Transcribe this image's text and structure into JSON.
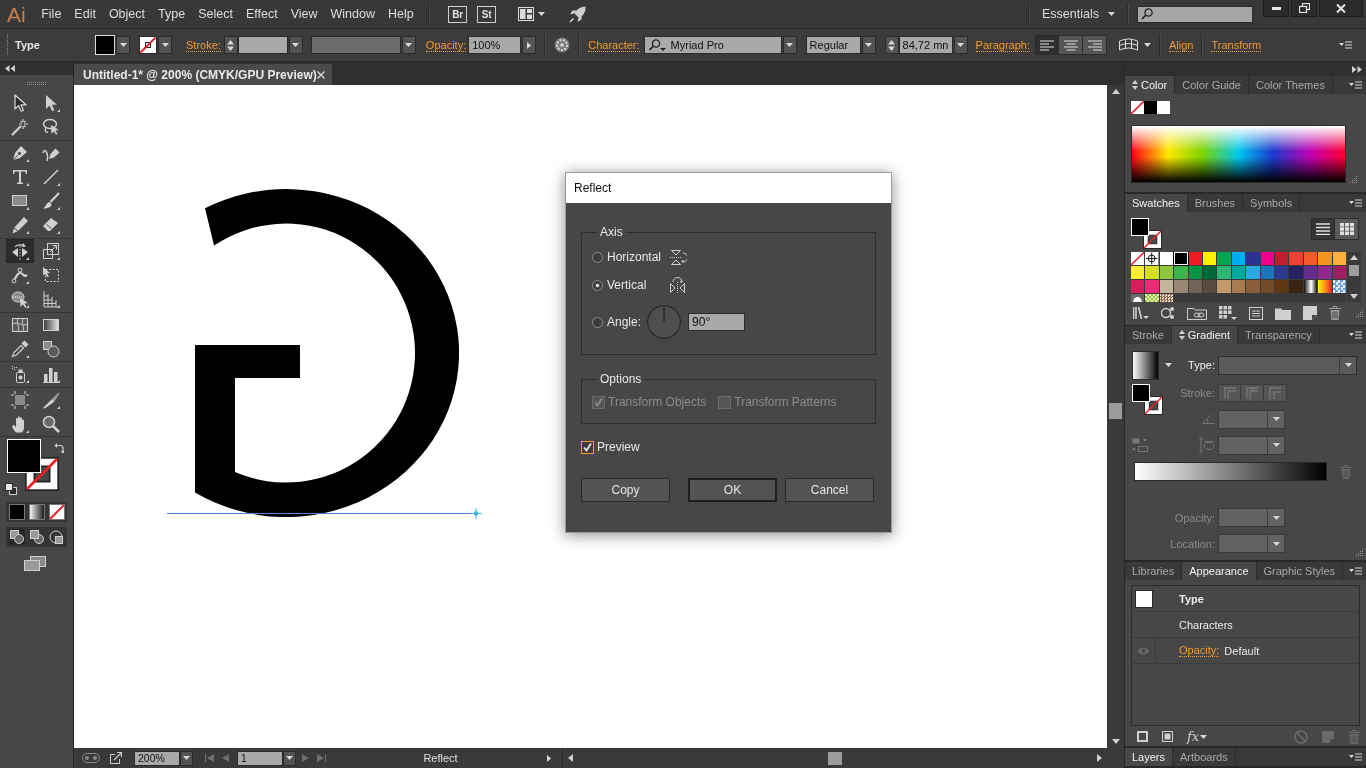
{
  "menu_bar": {
    "logo": "Ai",
    "menus": [
      "File",
      "Edit",
      "Object",
      "Type",
      "Select",
      "Effect",
      "View",
      "Window",
      "Help"
    ],
    "bridge_button": "Br",
    "stock_button": "St",
    "workspace": "Essentials"
  },
  "control_bar": {
    "selection": "Type",
    "stroke_label": "Stroke:",
    "opacity_label": "Opacity:",
    "opacity": "100%",
    "character_label": "Character:",
    "font_family": "Myriad Pro",
    "font_style": "Regular",
    "font_size": "84,72 mn",
    "paragraph_label": "Paragraph:",
    "alignment": [
      {
        "selected": true
      },
      {
        "selected": false
      },
      {
        "selected": false
      }
    ],
    "align_label": "Align",
    "transform_label": "Transform"
  },
  "toolbar": {
    "tools": [
      {
        "selected": false
      },
      {
        "selected": false
      },
      {
        "selected": false
      },
      {
        "selected": false
      },
      {
        "selected": false
      },
      {
        "selected": false
      },
      {
        "selected": false
      },
      {
        "selected": false
      },
      {
        "selected": false
      },
      {
        "selected": false
      },
      {
        "selected": false
      },
      {
        "selected": false
      },
      {
        "selected": true
      },
      {
        "selected": false
      },
      {
        "selected": false
      },
      {
        "selected": false
      },
      {
        "selected": false
      },
      {
        "selected": false
      },
      {
        "selected": false
      },
      {
        "selected": false
      },
      {
        "selected": false
      },
      {
        "selected": false
      },
      {
        "selected": false
      },
      {
        "selected": false
      },
      {
        "selected": false
      },
      {
        "selected": false
      },
      {
        "selected": false
      },
      {
        "selected": false
      }
    ],
    "draw_modes": [
      {
        "selected": true
      },
      {
        "selected": false
      },
      {
        "selected": false
      }
    ]
  },
  "document_tab": {
    "title": "Untitled-1* @ 200% (CMYK/GPU Preview)"
  },
  "dialog": {
    "title": "Reflect",
    "axis": {
      "label": "Axis",
      "options": [
        {
          "label": "Horizontal",
          "kind": "flip",
          "selected": false
        },
        {
          "label": "Vertical",
          "kind": "flip",
          "selected": true
        },
        {
          "label": "Angle:",
          "kind": "angle",
          "selected": false,
          "value": "90°"
        }
      ]
    },
    "options": {
      "label": "Options",
      "checkboxes": [
        {
          "label": "Transform Objects",
          "checked": true,
          "disabled": true
        },
        {
          "label": "Transform Patterns",
          "checked": false,
          "disabled": true
        }
      ]
    },
    "preview": {
      "label": "Preview",
      "checked": true,
      "focused": true
    },
    "buttons": [
      {
        "label": "Copy",
        "default": false
      },
      {
        "label": "OK",
        "default": true
      },
      {
        "label": "Cancel",
        "default": false
      }
    ]
  },
  "color_panel": {
    "tabs": [
      {
        "label": "Color",
        "selected": true
      },
      {
        "label": "Color Guide",
        "selected": false
      },
      {
        "label": "Color Themes",
        "selected": false
      }
    ],
    "options_toggle": true,
    "quick_swatches": [
      {
        "kind": "none"
      },
      {
        "kind": "color",
        "color": "#000000"
      },
      {
        "kind": "color",
        "color": "#ffffff"
      }
    ]
  },
  "swatches_panel": {
    "tabs": [
      {
        "label": "Swatches",
        "selected": true
      },
      {
        "label": "Brushes",
        "selected": false
      },
      {
        "label": "Symbols",
        "selected": false
      }
    ],
    "views": [
      {
        "selected": true
      },
      {
        "selected": false
      }
    ],
    "swatches": [
      {
        "kind": "none",
        "selected": false
      },
      {
        "kind": "registration",
        "selected": false
      },
      {
        "kind": "color",
        "color": "#ffffff",
        "selected": false
      },
      {
        "kind": "color",
        "color": "#000000",
        "selected": true
      },
      {
        "kind": "color",
        "color": "#ed1c24",
        "selected": false
      },
      {
        "kind": "color",
        "color": "#fff200",
        "selected": false
      },
      {
        "kind": "color",
        "color": "#00a651",
        "selected": false
      },
      {
        "kind": "color",
        "color": "#00aeef",
        "selected": false
      },
      {
        "kind": "color",
        "color": "#2e3192",
        "selected": false
      },
      {
        "kind": "color",
        "color": "#ec008c",
        "selected": false
      },
      {
        "kind": "color",
        "color": "#be1e2d",
        "selected": false
      },
      {
        "kind": "color",
        "color": "#ef4136",
        "selected": false
      },
      {
        "kind": "color",
        "color": "#f15a29",
        "selected": false
      },
      {
        "kind": "color",
        "color": "#f7941d",
        "selected": false
      },
      {
        "kind": "color",
        "color": "#fbb040",
        "selected": false
      },
      {
        "kind": "color",
        "color": "#f9ed32",
        "selected": false
      },
      {
        "kind": "color",
        "color": "#d7df23",
        "selected": false
      },
      {
        "kind": "color",
        "color": "#8dc63f",
        "selected": false
      },
      {
        "kind": "color",
        "color": "#39b54a",
        "selected": false
      },
      {
        "kind": "color",
        "color": "#009444",
        "selected": false
      },
      {
        "kind": "color",
        "color": "#006838",
        "selected": false
      },
      {
        "kind": "color",
        "color": "#2bb673",
        "selected": false
      },
      {
        "kind": "color",
        "color": "#00a79d",
        "selected": false
      },
      {
        "kind": "color",
        "color": "#27aae1",
        "selected": false
      },
      {
        "kind": "color",
        "color": "#1c75bc",
        "selected": false
      },
      {
        "kind": "color",
        "color": "#2b3990",
        "selected": false
      },
      {
        "kind": "color",
        "color": "#262262",
        "selected": false
      },
      {
        "kind": "color",
        "color": "#662d91",
        "selected": false
      },
      {
        "kind": "color",
        "color": "#92278f",
        "selected": false
      },
      {
        "kind": "color",
        "color": "#9e1f63",
        "selected": false
      },
      {
        "kind": "color",
        "color": "#da1c5c",
        "selected": false
      },
      {
        "kind": "color",
        "color": "#ee2a7b",
        "selected": false
      },
      {
        "kind": "color",
        "color": "#c2b59b",
        "selected": false
      },
      {
        "kind": "color",
        "color": "#998675",
        "selected": false
      },
      {
        "kind": "color",
        "color": "#736357",
        "selected": false
      },
      {
        "kind": "color",
        "color": "#594a42",
        "selected": false
      },
      {
        "kind": "color",
        "color": "#c49a6c",
        "selected": false
      },
      {
        "kind": "color",
        "color": "#a97c50",
        "selected": false
      },
      {
        "kind": "color",
        "color": "#8b5e3c",
        "selected": false
      },
      {
        "kind": "color",
        "color": "#754c29",
        "selected": false
      },
      {
        "kind": "color",
        "color": "#603913",
        "selected": false
      },
      {
        "kind": "color",
        "color": "#3c2415",
        "selected": false
      },
      {
        "kind": "gradient",
        "selected": false
      },
      {
        "kind": "gradient",
        "selected": false
      },
      {
        "kind": "pattern",
        "selected": false
      },
      {
        "kind": "pattern",
        "selected": false
      },
      {
        "kind": "pattern",
        "selected": false
      },
      {
        "kind": "pattern",
        "selected": false
      }
    ]
  },
  "gradient_panel": {
    "tabs": [
      {
        "label": "Stroke",
        "selected": false
      },
      {
        "label": "Gradient",
        "selected": true
      },
      {
        "label": "Transparency",
        "selected": false
      }
    ],
    "options_toggle": true,
    "type": {
      "label": "Type:",
      "disabled": false
    },
    "stroke": {
      "label": "Stroke:",
      "disabled": true
    },
    "angle": {
      "disabled": true
    },
    "aspect_ratio": {
      "disabled": true
    },
    "stops": [
      {
        "label": "Opacity:",
        "disabled": true
      },
      {
        "label": "Location:",
        "disabled": true
      }
    ]
  },
  "appearance_panel": {
    "tabs": [
      {
        "label": "Libraries",
        "selected": false
      },
      {
        "label": "Appearance",
        "selected": true
      },
      {
        "label": "Graphic Styles",
        "selected": false
      }
    ],
    "rows": [
      {
        "kind": "object",
        "label": "Type"
      },
      {
        "kind": "group",
        "label": "Characters"
      },
      {
        "kind": "attribute",
        "label": "Opacity:",
        "value": "Default"
      }
    ],
    "effects_button": "fx"
  },
  "layers_panel": {
    "tabs": [
      {
        "label": "Layers",
        "selected": true
      },
      {
        "label": "Artboards",
        "selected": false
      }
    ]
  },
  "status_bar": {
    "zoom": "200%",
    "artboard": "1",
    "status": "Reflect"
  }
}
